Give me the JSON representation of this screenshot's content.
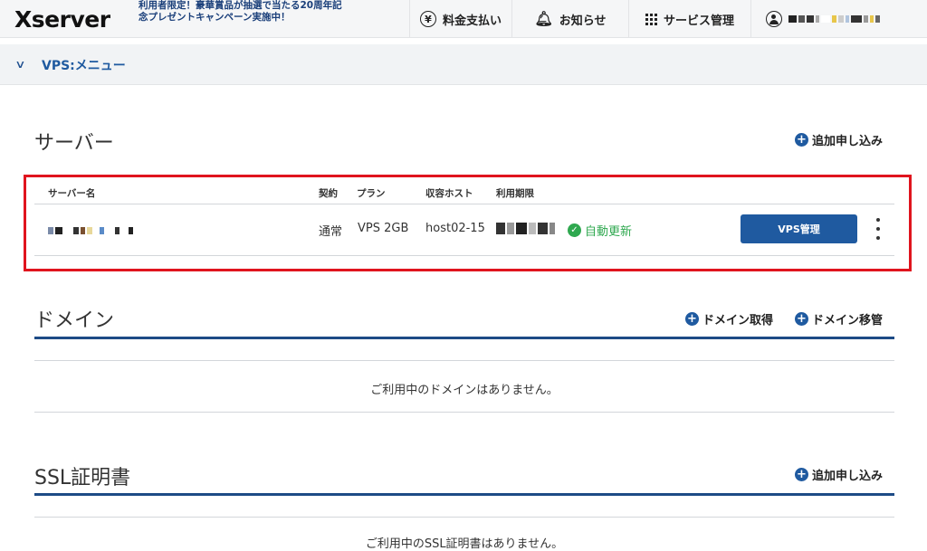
{
  "header": {
    "logo": "Xserver",
    "promo": "利用者限定！豪華賞品が抽選で当たる20周年記念プレゼントキャンペーン実施中！",
    "nav": {
      "payment_label": "料金支払い",
      "payment_icon": "yen-icon",
      "notice_label": "お知らせ",
      "notice_icon": "bell-icon",
      "services_label": "サービス管理",
      "services_icon": "grid-icon",
      "account_icon": "user-icon"
    }
  },
  "menu": {
    "label": "VPS:メニュー"
  },
  "server": {
    "title": "サーバー",
    "add_label": "追加申し込み",
    "columns": {
      "name": "サーバー名",
      "contract": "契約",
      "plan": "プラン",
      "host": "収容ホスト",
      "expiry": "利用期限"
    },
    "row": {
      "contract": "通常",
      "plan": "VPS 2GB",
      "host": "host02-15",
      "status": "自動更新",
      "manage_button": "VPS管理"
    },
    "colors": {
      "accent": "#1f5aa0",
      "status": "#2fa84f",
      "highlight": "#e0141e"
    }
  },
  "domain": {
    "title": "ドメイン",
    "acquire_label": "ドメイン取得",
    "transfer_label": "ドメイン移管",
    "empty": "ご利用中のドメインはありません。"
  },
  "ssl": {
    "title": "SSL証明書",
    "add_label": "追加申し込み",
    "empty": "ご利用中のSSL証明書はありません。"
  }
}
